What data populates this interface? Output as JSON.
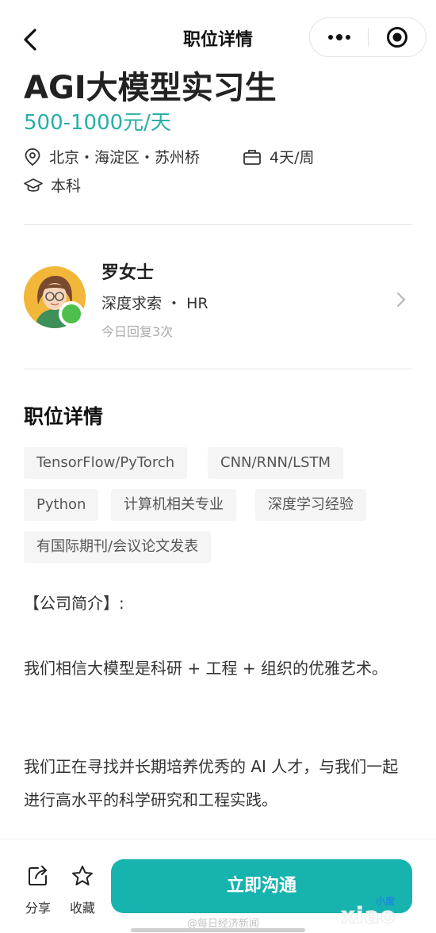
{
  "nav": {
    "title": "职位详情",
    "back_icon": "chevron-left-icon",
    "more_icon": "more-dots-icon",
    "close_icon": "target-circle-icon"
  },
  "job": {
    "title": "AGI大模型实习生",
    "salary": "500-1000元/天",
    "location": "北京・海淀区・苏州桥",
    "days": "4天/周",
    "education": "本科"
  },
  "recruiter": {
    "name": "罗女士",
    "company_role": "深度求索 ・ HR",
    "reply_status": "今日回复3次",
    "online_color": "#4cc04a"
  },
  "details": {
    "section_title": "职位详情",
    "tags": [
      "TensorFlow/PyTorch",
      "CNN/RNN/LSTM",
      "Python",
      "计算机相关专业",
      "深度学习经验",
      "有国际期刊/会议论文发表"
    ],
    "paragraphs": [
      "【公司简介】:",
      "我们相信大模型是科研 + 工程 + 组织的优雅艺术。",
      "我们正在寻找并长期培养优秀的 AI 人才，与我们一起进行高水平的科学研究和工程实践。"
    ]
  },
  "bottom_bar": {
    "share_label": "分享",
    "favorite_label": "收藏",
    "cta_label": "立即沟通"
  },
  "overlay": {
    "watermark": "@每日经济新闻",
    "logo_small": "小度",
    "logo_large": "xiao"
  },
  "colors": {
    "accent": "#17b3ae",
    "salary": "#26b0a8"
  }
}
